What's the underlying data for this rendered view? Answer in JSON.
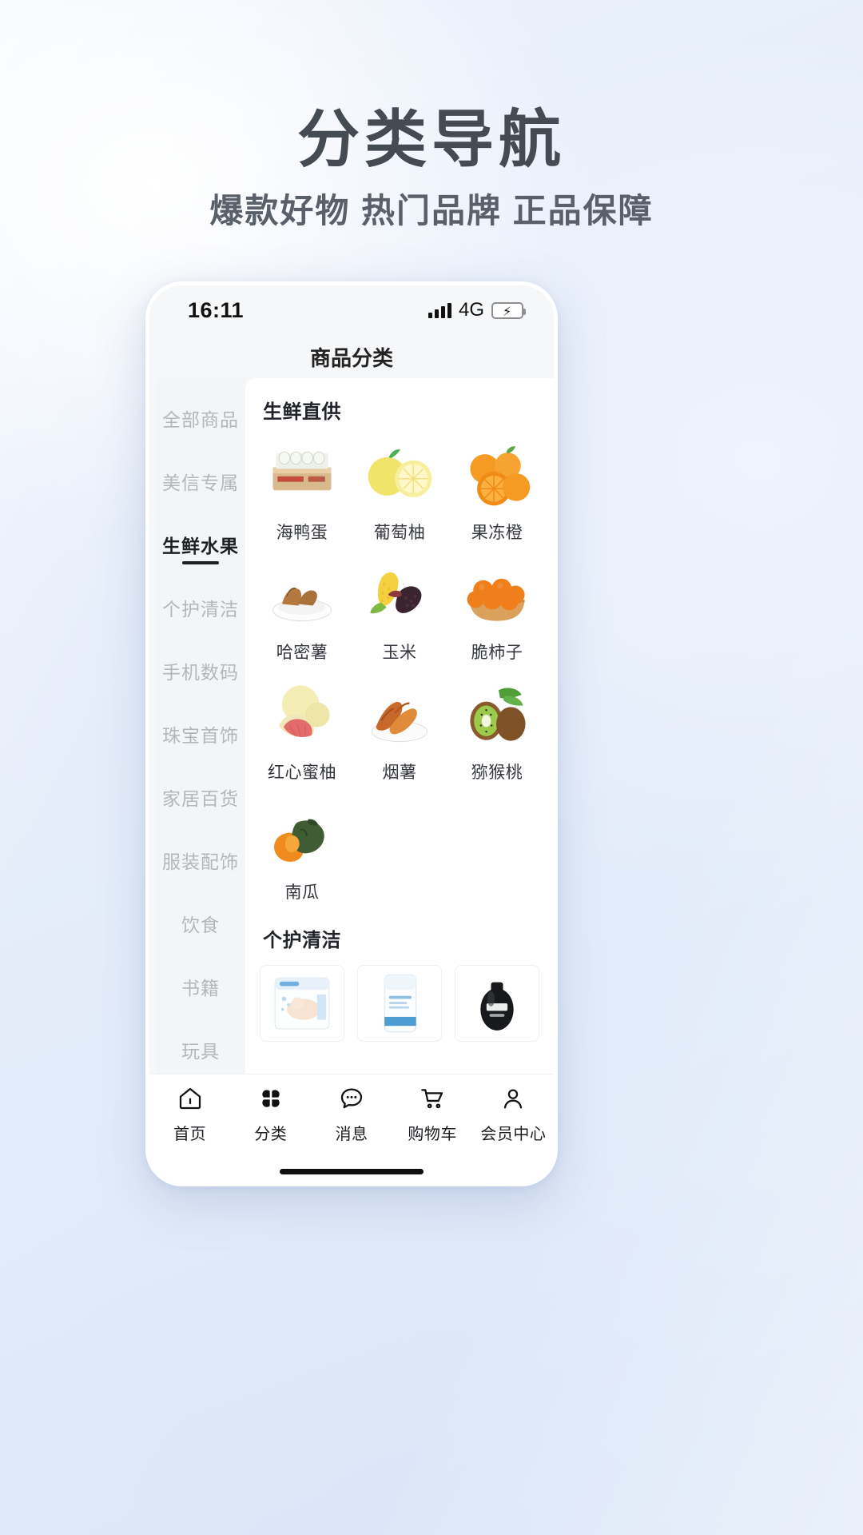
{
  "poster": {
    "title": "分类导航",
    "subtitle": "爆款好物 热门品牌 正品保障"
  },
  "status_bar": {
    "time": "16:11",
    "network": "4G",
    "signal_icon": "signal-bars-icon",
    "battery_icon": "battery-charging-icon",
    "battery_color": "#3ccf4e"
  },
  "page_title": "商品分类",
  "sidebar": {
    "items": [
      {
        "label": "全部商品",
        "active": false
      },
      {
        "label": "美信专属",
        "active": false
      },
      {
        "label": "生鲜水果",
        "active": true
      },
      {
        "label": "个护清洁",
        "active": false
      },
      {
        "label": "手机数码",
        "active": false
      },
      {
        "label": "珠宝首饰",
        "active": false
      },
      {
        "label": "家居百货",
        "active": false
      },
      {
        "label": "服装配饰",
        "active": false
      },
      {
        "label": "饮食",
        "active": false
      },
      {
        "label": "书籍",
        "active": false
      },
      {
        "label": "玩具",
        "active": false
      }
    ]
  },
  "sections": [
    {
      "title": "生鲜直供",
      "items": [
        {
          "label": "海鸭蛋",
          "icon": "egg-carton-icon"
        },
        {
          "label": "葡萄柚",
          "icon": "grapefruit-icon"
        },
        {
          "label": "果冻橙",
          "icon": "orange-icon"
        },
        {
          "label": "哈密薯",
          "icon": "sweet-potato-plate-icon"
        },
        {
          "label": "玉米",
          "icon": "corn-icon"
        },
        {
          "label": "脆柿子",
          "icon": "persimmon-basket-icon"
        },
        {
          "label": "红心蜜柚",
          "icon": "red-pomelo-icon"
        },
        {
          "label": "烟薯",
          "icon": "roasted-yam-icon"
        },
        {
          "label": "猕猴桃",
          "icon": "kiwi-icon"
        },
        {
          "label": "南瓜",
          "icon": "pumpkin-icon"
        }
      ]
    },
    {
      "title": "个护清洁",
      "items": [
        {
          "label": "",
          "icon": "diaper-pack-icon"
        },
        {
          "label": "",
          "icon": "wipes-pack-icon"
        },
        {
          "label": "",
          "icon": "shampoo-bottle-icon"
        }
      ]
    }
  ],
  "tabbar": {
    "items": [
      {
        "label": "首页",
        "icon": "home-icon",
        "active": false
      },
      {
        "label": "分类",
        "icon": "category-clover-icon",
        "active": true
      },
      {
        "label": "消息",
        "icon": "message-bubble-icon",
        "active": false
      },
      {
        "label": "购物车",
        "icon": "shopping-cart-icon",
        "active": false
      },
      {
        "label": "会员中心",
        "icon": "user-person-icon",
        "active": false
      }
    ]
  }
}
